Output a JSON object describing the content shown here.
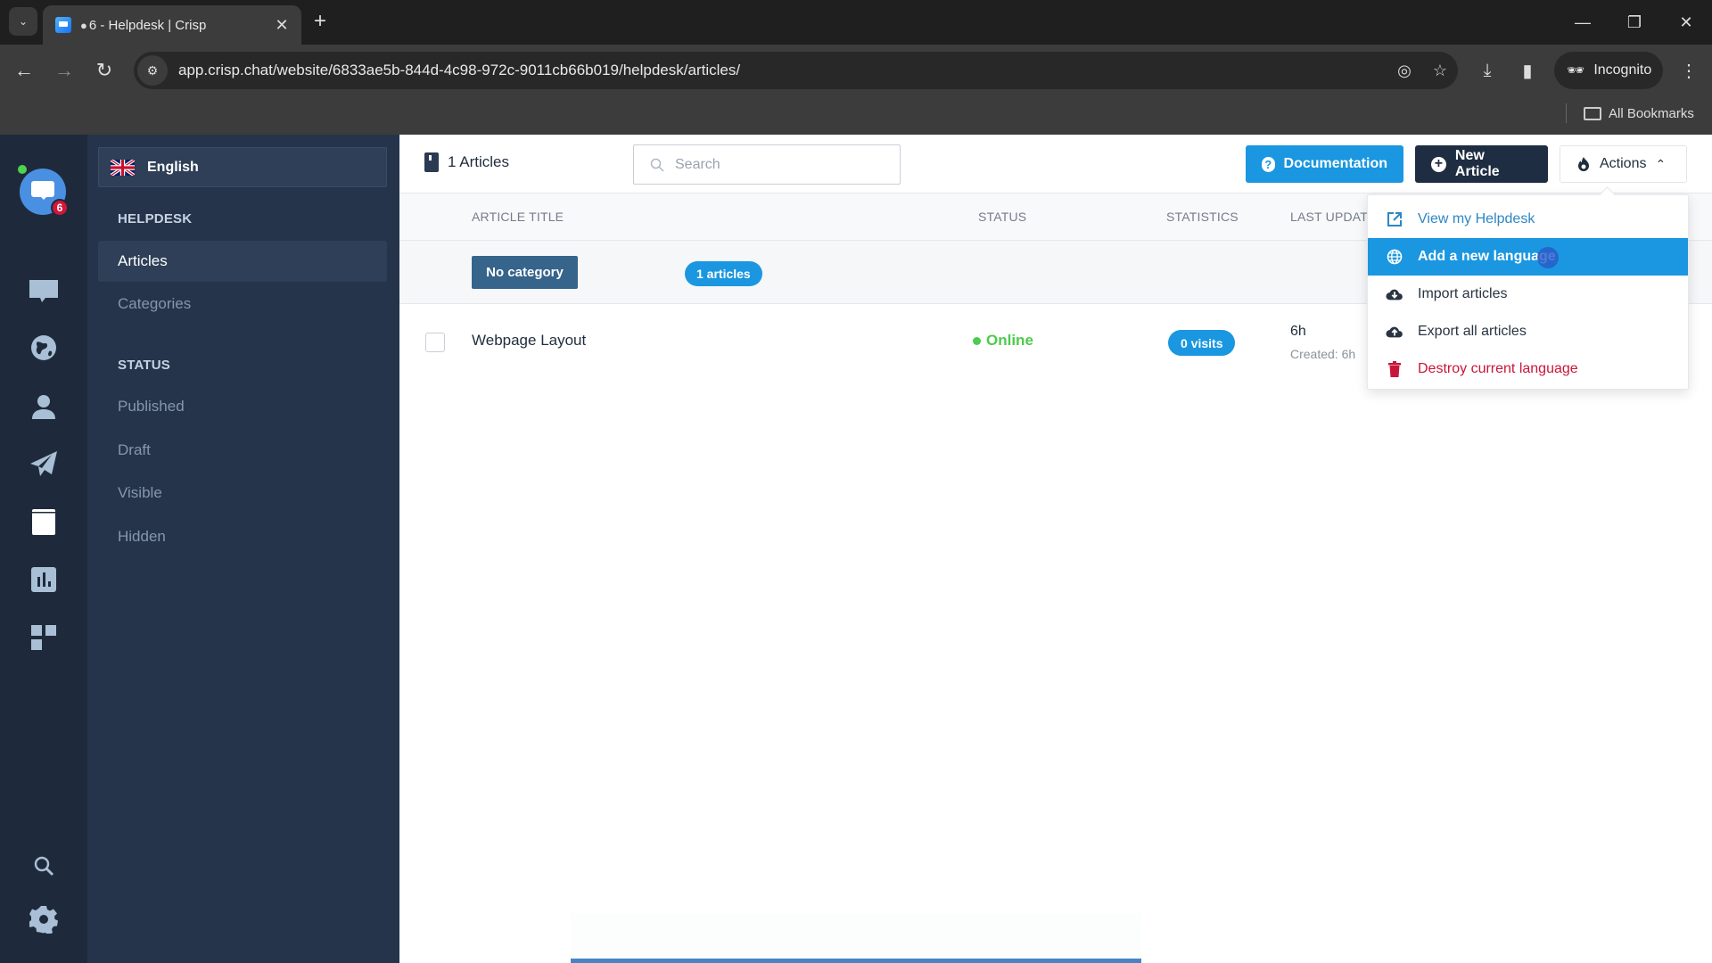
{
  "browser": {
    "tab_title": "6 - Helpdesk | Crisp",
    "tab_unread_icon": "chat-bubble-icon",
    "url": "app.crisp.chat/website/6833ae5b-844d-4c98-972c-9011cb66b019/helpdesk/articles/",
    "incognito_label": "Incognito",
    "bookmarks_label": "All Bookmarks",
    "glyphs": {
      "tab_menu": "⌄",
      "tab_close": "✕",
      "new_tab": "+",
      "minimize": "—",
      "maximize": "❐",
      "close": "✕",
      "back": "←",
      "forward": "→",
      "reload": "↻",
      "site_info": "⚙",
      "eye_off": "◎",
      "star": "☆",
      "download": "⤓",
      "side_panel": "▮",
      "incognito": "🕶",
      "more": "⋮"
    }
  },
  "rail": {
    "unread_badge": "6",
    "items": [
      "inbox-icon",
      "visitors-globe-icon",
      "contacts-icon",
      "campaigns-icon",
      "helpdesk-icon",
      "analytics-icon",
      "plugins-icon",
      "search-icon",
      "settings-icon"
    ]
  },
  "sidebar": {
    "language": "English",
    "helpdesk_heading": "HELPDESK",
    "nav": [
      {
        "label": "Articles",
        "active": true
      },
      {
        "label": "Categories",
        "active": false
      }
    ],
    "status_heading": "STATUS",
    "status_items": [
      "Published",
      "Draft",
      "Visible",
      "Hidden"
    ]
  },
  "header": {
    "articles_count": "1 Articles",
    "search_placeholder": "Search",
    "documentation_label": "Documentation",
    "documentation_icon": "?",
    "new_article_label": "New Article",
    "new_article_icon": "+",
    "actions_label": "Actions",
    "actions_chevron": "⌃"
  },
  "table": {
    "columns": [
      "ARTICLE TITLE",
      "STATUS",
      "STATISTICS",
      "LAST UPDAT"
    ],
    "category": {
      "name": "No category",
      "count": "1 articles"
    },
    "rows": [
      {
        "title": "Webpage Layout",
        "status": "Online",
        "visits": "0 visits",
        "updated": "6h",
        "created": "Created: 6h"
      }
    ]
  },
  "actions_menu": {
    "items": [
      {
        "label": "View my Helpdesk",
        "icon": "external-link-icon",
        "state": "link"
      },
      {
        "label": "Add a new language",
        "icon": "globe-icon",
        "state": "active"
      },
      {
        "label": "Import articles",
        "icon": "cloud-download-icon",
        "state": "normal"
      },
      {
        "label": "Export all articles",
        "icon": "cloud-upload-icon",
        "state": "normal"
      },
      {
        "label": "Destroy current language",
        "icon": "trash-icon",
        "state": "danger"
      }
    ]
  },
  "colors": {
    "accent": "#1a97e0",
    "online": "#4ccc4c",
    "danger": "#c8163a",
    "sidebar": "#25344b",
    "rail": "#1e2a3b"
  }
}
